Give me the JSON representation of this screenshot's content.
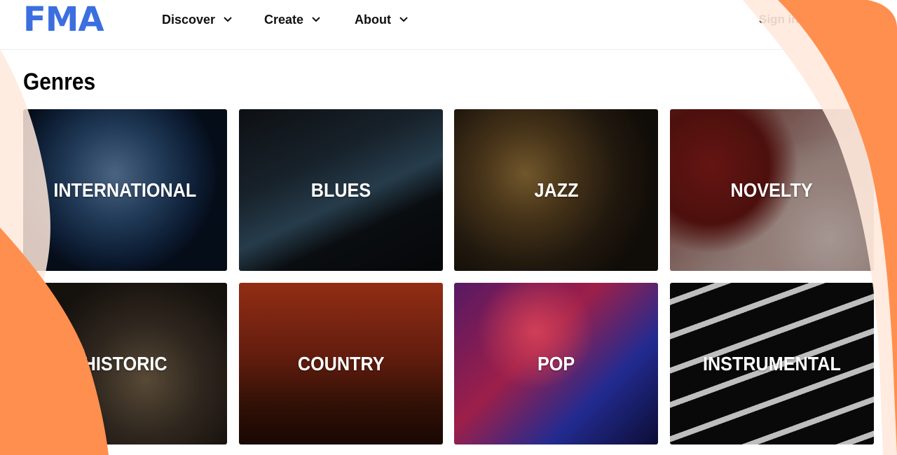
{
  "header": {
    "logo": "FMA",
    "nav": [
      {
        "label": "Discover"
      },
      {
        "label": "Create"
      },
      {
        "label": "About"
      }
    ],
    "signin": "Sign in"
  },
  "page": {
    "title": "Genres"
  },
  "genres": [
    {
      "label": "INTERNATIONAL"
    },
    {
      "label": "BLUES"
    },
    {
      "label": "JAZZ"
    },
    {
      "label": "NOVELTY"
    },
    {
      "label": "HISTORIC"
    },
    {
      "label": "COUNTRY"
    },
    {
      "label": "POP"
    },
    {
      "label": "INSTRUMENTAL"
    }
  ],
  "colors": {
    "logo": "#3b6fe0",
    "overlay_orange": "#ff8f4f",
    "overlay_light": "#ffe9dc"
  }
}
